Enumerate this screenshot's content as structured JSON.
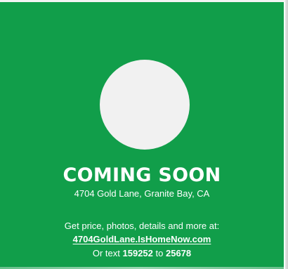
{
  "listing": {
    "headline": "COMING SOON",
    "address": "4704 Gold Lane, Granite Bay, CA",
    "cta_text": "Get price, photos, details and more at:",
    "url": "4704GoldLane.IsHomeNow.com",
    "text_prefix": "Or text",
    "text_code": "159252",
    "text_to": "to",
    "text_number": "25678"
  },
  "colors": {
    "background": "#119e4a",
    "text": "#ffffff",
    "photo_placeholder": "#f1f1f1"
  }
}
